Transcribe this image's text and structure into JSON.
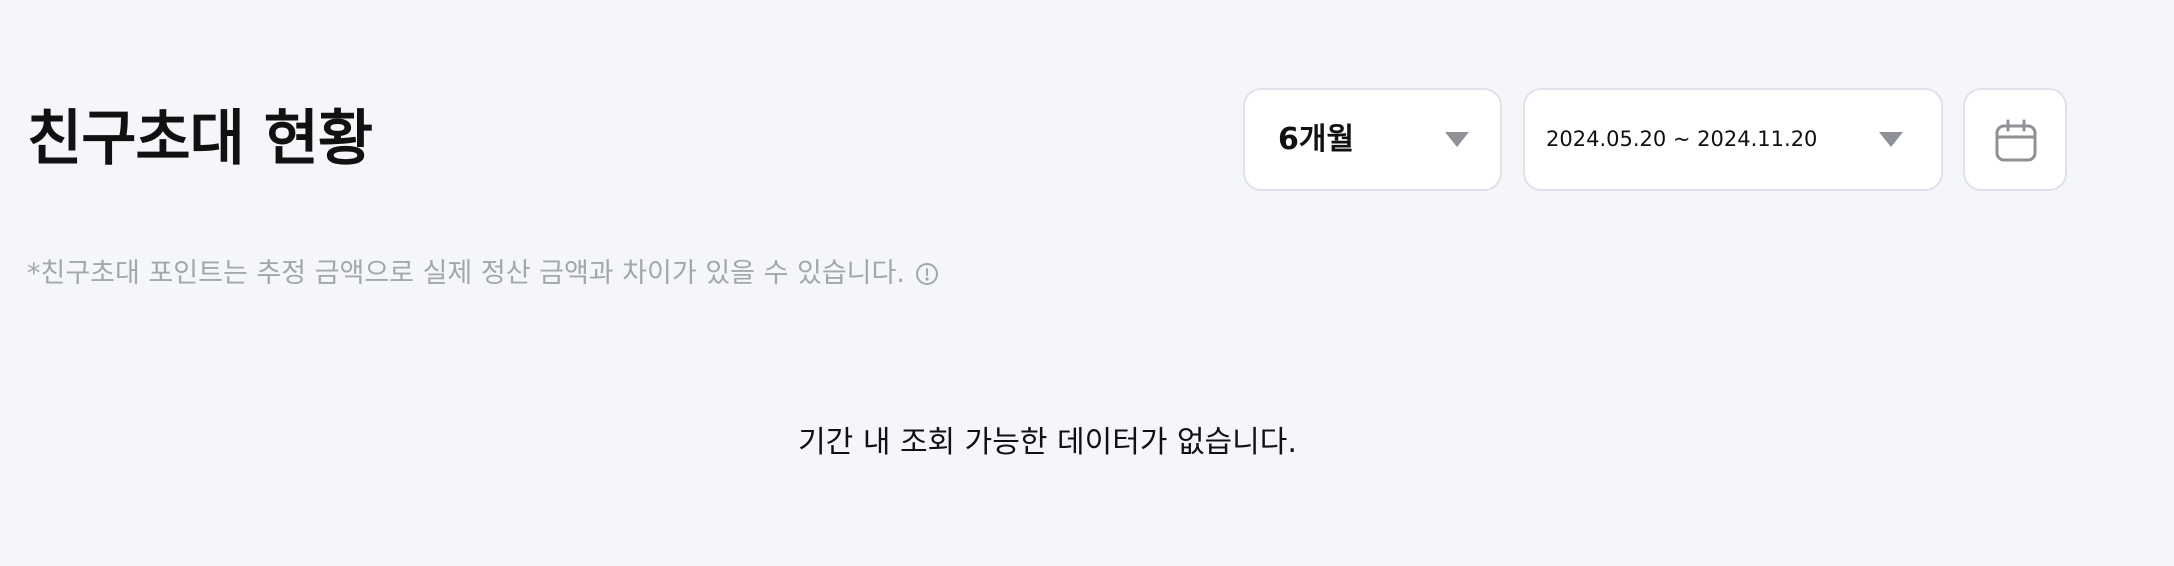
{
  "header": {
    "title": "친구초대 현황"
  },
  "filters": {
    "period_label": "6개월",
    "date_range_label": "2024.05.20 ~ 2024.11.20",
    "caret_icon": "caret-down-icon",
    "calendar_icon": "calendar-icon"
  },
  "notice": {
    "text": "*친구초대 포인트는 추정 금액으로 실제 정산 금액과 차이가 있을 수 있습니다.",
    "info_icon": "info-icon"
  },
  "content": {
    "empty_message": "기간 내 조회 가능한 데이터가 없습니다."
  },
  "colors": {
    "background": "#f5f6fa",
    "text_primary": "#111111",
    "text_muted": "#a3a6ab",
    "border": "#dfe2e8",
    "icon": "#8e9196"
  }
}
